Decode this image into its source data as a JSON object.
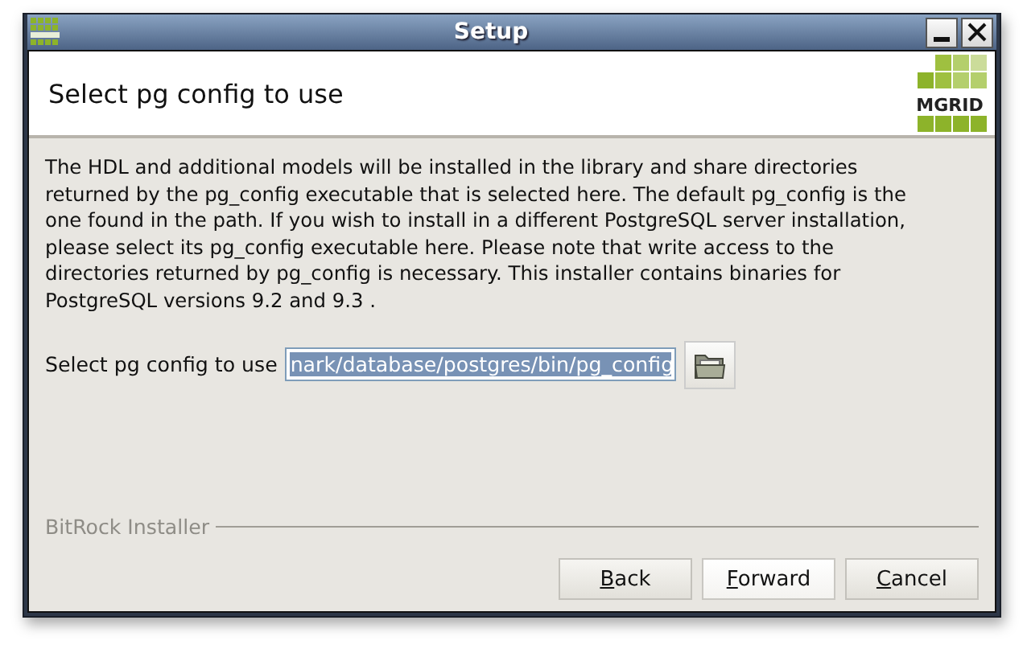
{
  "window": {
    "title": "Setup",
    "controls": [
      {
        "kind": "minimize"
      },
      {
        "kind": "close"
      }
    ]
  },
  "header": {
    "title": "Select pg config to use",
    "logo": "MGRID"
  },
  "description": "The HDL and additional models will be installed in the library and share directories\nreturned by the pg_config executable that is selected here.  The default pg_config is the\none found in the path.  If you wish to install in a different PostgreSQL server installation,\nplease select its pg_config executable here.  Please note that write access to the\ndirectories returned by pg_config is necessary.  This installer contains binaries for\nPostgreSQL versions 9.2 and 9.3 .",
  "field": {
    "label": "Select pg config to use",
    "value": "nark/database/postgres/bin/pg_config",
    "selected": true
  },
  "footer": {
    "brand": "BitRock Installer"
  },
  "buttons": [
    {
      "label": "Back",
      "default": false
    },
    {
      "label": "Forward",
      "default": true
    },
    {
      "label": "Cancel",
      "default": false
    }
  ]
}
